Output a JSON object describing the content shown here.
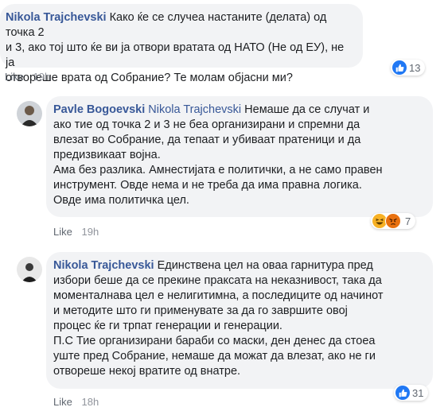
{
  "comments": [
    {
      "author": "Nikola Trajchevski",
      "mention": "",
      "lines": [
        "Како ќе се случеа настаните (делата) од точка 2",
        "и 3, ако тој што ќе ви ја отвори вратата од НАТО (Не од ЕУ), не ја",
        "отвореше врата од Собрание? Те молам објасни ми?"
      ],
      "like_label": "Like",
      "time": "19h",
      "reaction_count": "13",
      "reaction_icons": [
        "like-icon"
      ]
    },
    {
      "author": "Pavle Bogoevski",
      "mention": "Nikola Trajchevski",
      "lines": [
        "Немаше да се случат и",
        "ако тие од точка 2 и 3 не беа организирани и спремни да",
        "влезат во Собрание, да тепаат и убиваат пратеници и да",
        "предизвикаат војна.",
        "Ама без разлика. Амнестијата е политички, а не само правен",
        "инструмент. Овде нема и не треба да има правна логика.",
        "Овде има политичка цел."
      ],
      "like_label": "Like",
      "time": "19h",
      "reaction_count": "7",
      "reaction_icons": [
        "haha-icon",
        "angry-icon"
      ]
    },
    {
      "author": "Nikola Trajchevski",
      "mention": "",
      "lines": [
        "Единствена цел на оваа гарнитура пред",
        "избори беше да се прекине праксата на неказнивост, така да",
        "моменталнава цел е нелигитимна, а последиците од начинот",
        "и методите што ги применувате за да го завршите овој",
        "процес ќе ги трпат генерации и генерации.",
        "П.С Тие организирани бараби со маски, ден денес да стоеа",
        "уште пред Собрание, немаше да можат да влезат, ако не ги",
        "отвореше некој вратите од внатре."
      ],
      "like_label": "Like",
      "time": "18h",
      "reaction_count": "31",
      "reaction_icons": [
        "like-icon"
      ]
    }
  ],
  "colors": {
    "author": "#385898",
    "bubble": "#f2f3f5",
    "like_blue": "#2078f4"
  }
}
